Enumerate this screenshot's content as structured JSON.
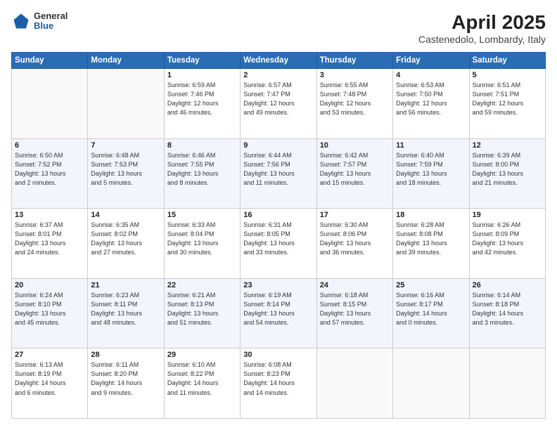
{
  "header": {
    "logo": {
      "general": "General",
      "blue": "Blue"
    },
    "title": "April 2025",
    "location": "Castenedolo, Lombardy, Italy"
  },
  "weekdays": [
    "Sunday",
    "Monday",
    "Tuesday",
    "Wednesday",
    "Thursday",
    "Friday",
    "Saturday"
  ],
  "weeks": [
    [
      {
        "day": "",
        "info": ""
      },
      {
        "day": "",
        "info": ""
      },
      {
        "day": "1",
        "info": "Sunrise: 6:59 AM\nSunset: 7:46 PM\nDaylight: 12 hours\nand 46 minutes."
      },
      {
        "day": "2",
        "info": "Sunrise: 6:57 AM\nSunset: 7:47 PM\nDaylight: 12 hours\nand 49 minutes."
      },
      {
        "day": "3",
        "info": "Sunrise: 6:55 AM\nSunset: 7:48 PM\nDaylight: 12 hours\nand 53 minutes."
      },
      {
        "day": "4",
        "info": "Sunrise: 6:53 AM\nSunset: 7:50 PM\nDaylight: 12 hours\nand 56 minutes."
      },
      {
        "day": "5",
        "info": "Sunrise: 6:51 AM\nSunset: 7:51 PM\nDaylight: 12 hours\nand 59 minutes."
      }
    ],
    [
      {
        "day": "6",
        "info": "Sunrise: 6:50 AM\nSunset: 7:52 PM\nDaylight: 13 hours\nand 2 minutes."
      },
      {
        "day": "7",
        "info": "Sunrise: 6:48 AM\nSunset: 7:53 PM\nDaylight: 13 hours\nand 5 minutes."
      },
      {
        "day": "8",
        "info": "Sunrise: 6:46 AM\nSunset: 7:55 PM\nDaylight: 13 hours\nand 8 minutes."
      },
      {
        "day": "9",
        "info": "Sunrise: 6:44 AM\nSunset: 7:56 PM\nDaylight: 13 hours\nand 11 minutes."
      },
      {
        "day": "10",
        "info": "Sunrise: 6:42 AM\nSunset: 7:57 PM\nDaylight: 13 hours\nand 15 minutes."
      },
      {
        "day": "11",
        "info": "Sunrise: 6:40 AM\nSunset: 7:59 PM\nDaylight: 13 hours\nand 18 minutes."
      },
      {
        "day": "12",
        "info": "Sunrise: 6:39 AM\nSunset: 8:00 PM\nDaylight: 13 hours\nand 21 minutes."
      }
    ],
    [
      {
        "day": "13",
        "info": "Sunrise: 6:37 AM\nSunset: 8:01 PM\nDaylight: 13 hours\nand 24 minutes."
      },
      {
        "day": "14",
        "info": "Sunrise: 6:35 AM\nSunset: 8:02 PM\nDaylight: 13 hours\nand 27 minutes."
      },
      {
        "day": "15",
        "info": "Sunrise: 6:33 AM\nSunset: 8:04 PM\nDaylight: 13 hours\nand 30 minutes."
      },
      {
        "day": "16",
        "info": "Sunrise: 6:31 AM\nSunset: 8:05 PM\nDaylight: 13 hours\nand 33 minutes."
      },
      {
        "day": "17",
        "info": "Sunrise: 6:30 AM\nSunset: 8:06 PM\nDaylight: 13 hours\nand 36 minutes."
      },
      {
        "day": "18",
        "info": "Sunrise: 6:28 AM\nSunset: 8:08 PM\nDaylight: 13 hours\nand 39 minutes."
      },
      {
        "day": "19",
        "info": "Sunrise: 6:26 AM\nSunset: 8:09 PM\nDaylight: 13 hours\nand 42 minutes."
      }
    ],
    [
      {
        "day": "20",
        "info": "Sunrise: 6:24 AM\nSunset: 8:10 PM\nDaylight: 13 hours\nand 45 minutes."
      },
      {
        "day": "21",
        "info": "Sunrise: 6:23 AM\nSunset: 8:11 PM\nDaylight: 13 hours\nand 48 minutes."
      },
      {
        "day": "22",
        "info": "Sunrise: 6:21 AM\nSunset: 8:13 PM\nDaylight: 13 hours\nand 51 minutes."
      },
      {
        "day": "23",
        "info": "Sunrise: 6:19 AM\nSunset: 8:14 PM\nDaylight: 13 hours\nand 54 minutes."
      },
      {
        "day": "24",
        "info": "Sunrise: 6:18 AM\nSunset: 8:15 PM\nDaylight: 13 hours\nand 57 minutes."
      },
      {
        "day": "25",
        "info": "Sunrise: 6:16 AM\nSunset: 8:17 PM\nDaylight: 14 hours\nand 0 minutes."
      },
      {
        "day": "26",
        "info": "Sunrise: 6:14 AM\nSunset: 8:18 PM\nDaylight: 14 hours\nand 3 minutes."
      }
    ],
    [
      {
        "day": "27",
        "info": "Sunrise: 6:13 AM\nSunset: 8:19 PM\nDaylight: 14 hours\nand 6 minutes."
      },
      {
        "day": "28",
        "info": "Sunrise: 6:11 AM\nSunset: 8:20 PM\nDaylight: 14 hours\nand 9 minutes."
      },
      {
        "day": "29",
        "info": "Sunrise: 6:10 AM\nSunset: 8:22 PM\nDaylight: 14 hours\nand 11 minutes."
      },
      {
        "day": "30",
        "info": "Sunrise: 6:08 AM\nSunset: 8:23 PM\nDaylight: 14 hours\nand 14 minutes."
      },
      {
        "day": "",
        "info": ""
      },
      {
        "day": "",
        "info": ""
      },
      {
        "day": "",
        "info": ""
      }
    ]
  ]
}
